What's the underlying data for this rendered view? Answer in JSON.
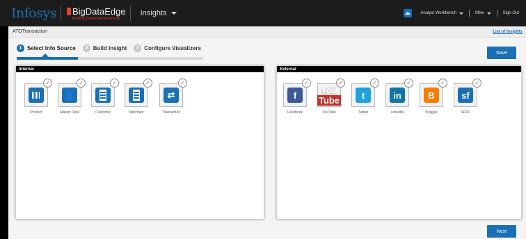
{
  "header": {
    "logo": "Infosys",
    "product_name": "BigDataEdge",
    "product_tagline": "Building Tomorrow's Enterprise",
    "section": "Insights",
    "workbench": "Analyst Workbench",
    "user": "Mike",
    "signout": "Sign Out"
  },
  "breadcrumb": {
    "title": "ATOTransaction",
    "list_link": "List of Insights"
  },
  "steps": [
    {
      "num": "1",
      "label": "Select Info Source"
    },
    {
      "num": "2",
      "label": "Build Insight"
    },
    {
      "num": "3",
      "label": "Configure Visualizers"
    }
  ],
  "progress_fraction": 0.33,
  "buttons": {
    "save": "Save",
    "next": "Next"
  },
  "internal": {
    "title": "Internal",
    "sources": [
      {
        "label": "Product",
        "icon": "barcode-icon"
      },
      {
        "label": "Master Data",
        "icon": "person-card-icon"
      },
      {
        "label": "Customer",
        "icon": "building-icon"
      },
      {
        "label": "Merchant",
        "icon": "building-icon"
      },
      {
        "label": "Transaction",
        "icon": "transaction-icon"
      }
    ]
  },
  "external": {
    "title": "External",
    "sources": [
      {
        "label": "Facebook",
        "icon": "facebook-icon",
        "glyph": "f"
      },
      {
        "label": "YouTube",
        "icon": "youtube-icon",
        "glyph": "You Tube"
      },
      {
        "label": "Twitter",
        "icon": "twitter-icon",
        "glyph": "t"
      },
      {
        "label": "LinkedIn",
        "icon": "linkedin-icon",
        "glyph": "in"
      },
      {
        "label": "Blogger",
        "icon": "blogger-icon",
        "glyph": "B"
      },
      {
        "label": "SFDC",
        "icon": "salesforce-icon",
        "glyph": "sf"
      }
    ]
  },
  "colors": {
    "accent": "#1a6fb5",
    "topbar": "#1c1c1c"
  }
}
